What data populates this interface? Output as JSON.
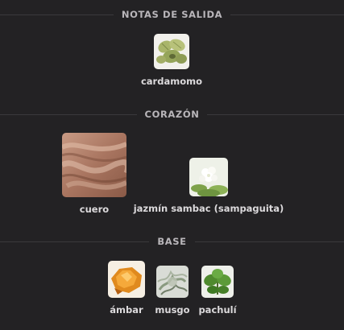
{
  "sections": {
    "top": {
      "title": "NOTAS DE SALIDA",
      "notes": [
        {
          "name": "cardamomo",
          "icon": "cardamom-image"
        }
      ]
    },
    "heart": {
      "title": "CORAZÓN",
      "notes": [
        {
          "name": "cuero",
          "icon": "leather-image"
        },
        {
          "name": "jazmín sambac (sampaguita)",
          "icon": "jasmine-image"
        }
      ]
    },
    "base": {
      "title": "BASE",
      "notes": [
        {
          "name": "ámbar",
          "icon": "amber-image"
        },
        {
          "name": "musgo",
          "icon": "moss-image"
        },
        {
          "name": "pachulí",
          "icon": "patchouli-image"
        }
      ]
    }
  },
  "colors": {
    "background": "#232224",
    "divider": "#3a393c",
    "header_text": "#b9b6ba",
    "note_text": "#dcdadc"
  }
}
